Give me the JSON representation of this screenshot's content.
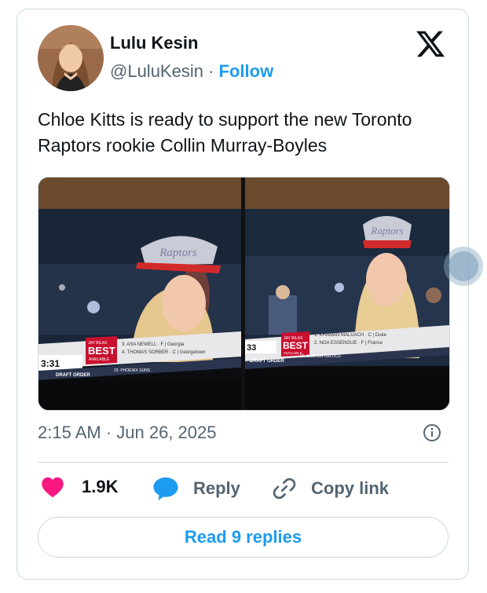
{
  "tweet": {
    "author_name": "Lulu Kesin",
    "handle": "@LuluKesin",
    "separator": "·",
    "follow_label": "Follow",
    "text": "Chloe Kitts is ready to support the new Toronto Raptors rookie Collin Murray-Boyles",
    "timestamp": "2:15 AM · Jun 26, 2025",
    "brand_icon": "x-logo-icon"
  },
  "media": {
    "photo1": {
      "hat_text": "Raptors",
      "ticker_tag": "JAY BILAS",
      "ticker_best": "BEST",
      "ticker_available": "AVAILABLE",
      "ticker_line1": "3. ASA NEWELL · F | Georgia",
      "ticker_line2": "4. THOMAS SORBER · C | Georgetown",
      "clock": "3:31",
      "draft_order": "DRAFT ORDER",
      "next_pick": "29. PHOENIX SUNS"
    },
    "photo2": {
      "hat_text": "Raptors",
      "ticker_tag": "JAY BILAS",
      "ticker_best": "BEST",
      "ticker_available": "AVAILABLE",
      "ticker_line1": "1. KHAMAN MALUACH · C | Duke",
      "ticker_line2": "2. NOA ESSENGUE · F | France",
      "clock": "33",
      "draft_order": "DRAFT ORDER",
      "next_pick": "26. BOSTON CELTICS"
    }
  },
  "actions": {
    "like_count": "1.9K",
    "reply_label": "Reply",
    "copy_label": "Copy link"
  },
  "read_replies_label": "Read 9 replies",
  "colors": {
    "accent": "#1d9bf0",
    "like": "#f91880",
    "muted_text": "#536471",
    "border": "#cfd9de"
  }
}
